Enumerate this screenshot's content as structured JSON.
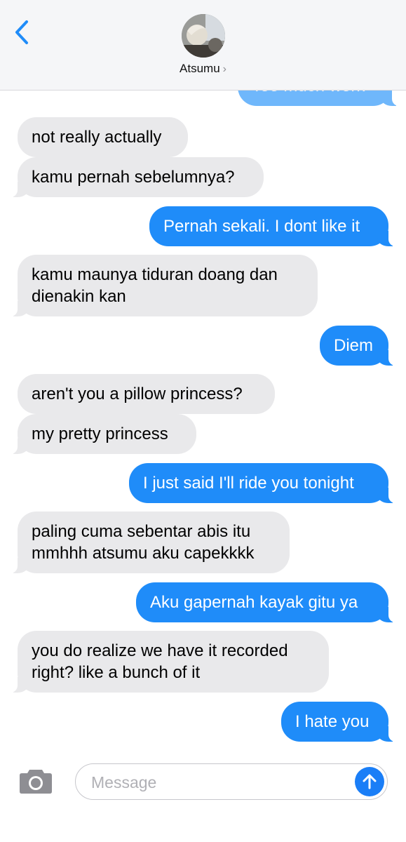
{
  "header": {
    "contact_name": "Atsumu",
    "back_icon": "chevron-left-icon",
    "avatar_icon": "contact-photo"
  },
  "colors": {
    "incoming_bubble": "#e9e9eb",
    "outgoing_bubble": "#1f8cf9",
    "accent": "#1a7ef7"
  },
  "messages": [
    {
      "direction": "outgoing",
      "text": "Too much work"
    },
    {
      "direction": "incoming",
      "text": "not really actually"
    },
    {
      "direction": "incoming",
      "text": "kamu pernah sebelumnya?"
    },
    {
      "direction": "outgoing",
      "text": "Pernah sekali. I dont like it"
    },
    {
      "direction": "incoming",
      "text": "kamu maunya tiduran doang dan dienakin kan"
    },
    {
      "direction": "outgoing",
      "text": "Diem"
    },
    {
      "direction": "incoming",
      "text": "aren't you a pillow princess?"
    },
    {
      "direction": "incoming",
      "text": "my pretty princess"
    },
    {
      "direction": "outgoing",
      "text": "I just said I'll ride you tonight"
    },
    {
      "direction": "incoming",
      "text": "paling cuma sebentar abis itu mmhhh atsumu aku capekkkk"
    },
    {
      "direction": "outgoing",
      "text": "Aku gapernah kayak gitu ya"
    },
    {
      "direction": "incoming",
      "text": "you do realize we have it recorded right? like a bunch of it"
    },
    {
      "direction": "outgoing",
      "text": "I hate you"
    }
  ],
  "composer": {
    "placeholder": "Message",
    "value": "",
    "camera_icon": "camera-icon",
    "send_icon": "arrow-up-icon"
  }
}
